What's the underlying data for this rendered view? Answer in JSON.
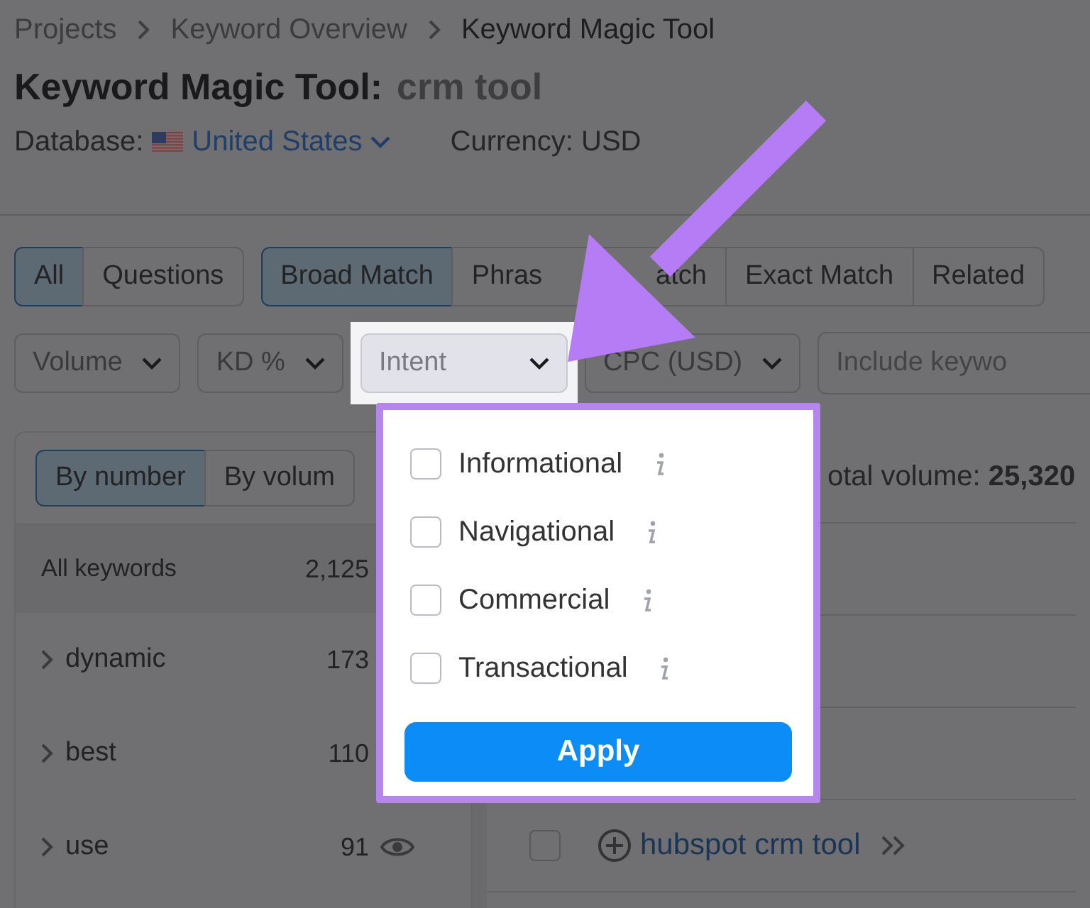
{
  "breadcrumbs": [
    {
      "label": "Projects",
      "current": false
    },
    {
      "label": "Keyword Overview",
      "current": false
    },
    {
      "label": "Keyword Magic Tool",
      "current": true
    }
  ],
  "title": "Keyword Magic Tool:",
  "query": "crm tool",
  "database": {
    "label": "Database:",
    "value": "United States"
  },
  "currency": "Currency: USD",
  "tab_groups": [
    [
      {
        "label": "All",
        "selected": true
      },
      {
        "label": "Questions",
        "selected": false
      }
    ],
    [
      {
        "label": "Broad Match",
        "selected": true
      },
      {
        "label": "Phras",
        "label_end": "atch",
        "selected": false
      },
      {
        "label": "Exact Match",
        "selected": false
      },
      {
        "label": "Related",
        "selected": false
      }
    ]
  ],
  "filters": [
    {
      "kind": "dropdown",
      "label": "Volume",
      "open": false
    },
    {
      "kind": "dropdown",
      "label": "KD %",
      "open": false
    },
    {
      "kind": "dropdown",
      "label": "Intent",
      "open": true
    },
    {
      "kind": "dropdown",
      "label": "CPC (USD)",
      "open": false
    },
    {
      "kind": "field",
      "placeholder": "Include keywo"
    }
  ],
  "intent_menu": {
    "options": [
      {
        "label": "Informational",
        "checked": false
      },
      {
        "label": "Navigational",
        "checked": false
      },
      {
        "label": "Commercial",
        "checked": false
      },
      {
        "label": "Transactional",
        "checked": false
      }
    ],
    "apply": "Apply"
  },
  "group_view": [
    {
      "label": "By number",
      "selected": true
    },
    {
      "label": "By volum",
      "selected": false
    }
  ],
  "groups": [
    {
      "kind": "total",
      "label": "All keywords",
      "count": "2,125"
    },
    {
      "kind": "group",
      "label": "dynamic",
      "count": "173"
    },
    {
      "kind": "group",
      "label": "best",
      "count": "110"
    },
    {
      "kind": "group_with_eye",
      "label": "use",
      "count": "91"
    }
  ],
  "summary": "otal volume: **25,320**",
  "keywords": [
    {
      "keyword": "hubspot crm tool",
      "checked": false
    }
  ]
}
